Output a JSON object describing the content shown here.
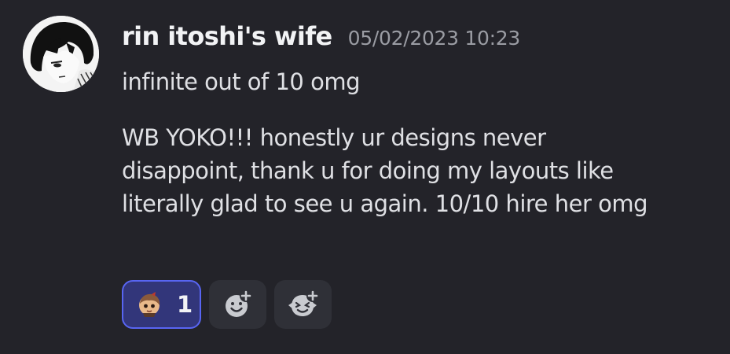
{
  "message": {
    "author": "rin itoshi's wife",
    "timestamp": "05/02/2023 10:23",
    "lines": [
      "infinite out of 10 omg",
      "WB YOKO!!! honestly ur designs never",
      "disappoint, thank u for doing my layouts like",
      "literally glad to see u again. 10/10 hire her omg"
    ]
  },
  "reactions": [
    {
      "emoji": "custom-character-emoji",
      "count": "1",
      "active": true
    },
    {
      "icon": "add-reaction-icon"
    },
    {
      "icon": "add-super-reaction-icon"
    }
  ],
  "colors": {
    "background": "#232329",
    "username": "#f2f3f5",
    "timestamp": "#9a9ca3",
    "text": "#dfe0e4",
    "reaction_active_bg": "#32367a",
    "reaction_active_border": "#5865f2",
    "reaction_bg": "#2f3037"
  }
}
